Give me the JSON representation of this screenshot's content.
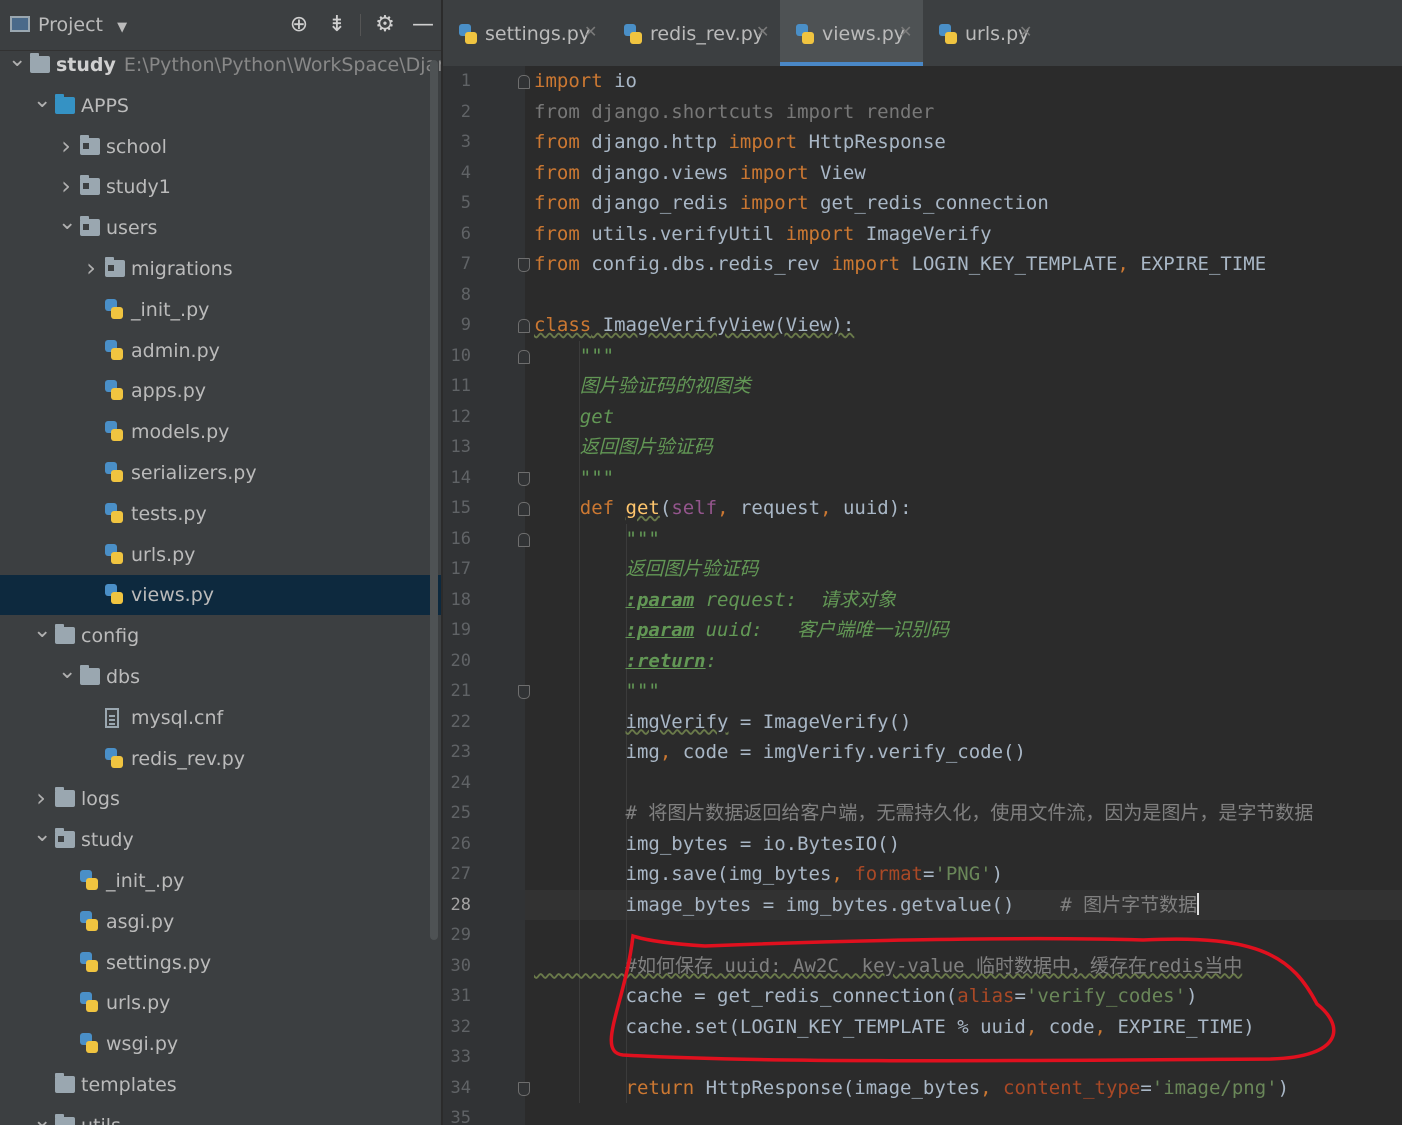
{
  "project_panel": {
    "title": "Project",
    "header_icons": [
      "locate-icon",
      "collapse-icon",
      "gear-icon",
      "minimize-icon"
    ],
    "tree": [
      {
        "label": "study",
        "path": "E:\\Python\\Python\\WorkSpace\\Django\\s",
        "depth": 0,
        "type": "folder",
        "expanded": true
      },
      {
        "label": "APPS",
        "depth": 1,
        "type": "folder-blue",
        "expanded": true
      },
      {
        "label": "school",
        "depth": 2,
        "type": "package",
        "expanded": false
      },
      {
        "label": "study1",
        "depth": 2,
        "type": "package",
        "expanded": false
      },
      {
        "label": "users",
        "depth": 2,
        "type": "package",
        "expanded": true
      },
      {
        "label": "migrations",
        "depth": 3,
        "type": "package",
        "expanded": false
      },
      {
        "label": "_init_.py",
        "depth": 3,
        "type": "py"
      },
      {
        "label": "admin.py",
        "depth": 3,
        "type": "py"
      },
      {
        "label": "apps.py",
        "depth": 3,
        "type": "py"
      },
      {
        "label": "models.py",
        "depth": 3,
        "type": "py"
      },
      {
        "label": "serializers.py",
        "depth": 3,
        "type": "py"
      },
      {
        "label": "tests.py",
        "depth": 3,
        "type": "py"
      },
      {
        "label": "urls.py",
        "depth": 3,
        "type": "py"
      },
      {
        "label": "views.py",
        "depth": 3,
        "type": "py",
        "selected": true
      },
      {
        "label": "config",
        "depth": 1,
        "type": "folder",
        "expanded": true
      },
      {
        "label": "dbs",
        "depth": 2,
        "type": "folder",
        "expanded": true
      },
      {
        "label": "mysql.cnf",
        "depth": 3,
        "type": "cnf"
      },
      {
        "label": "redis_rev.py",
        "depth": 3,
        "type": "py"
      },
      {
        "label": "logs",
        "depth": 1,
        "type": "folder",
        "expanded": false
      },
      {
        "label": "study",
        "depth": 1,
        "type": "package",
        "expanded": true
      },
      {
        "label": "_init_.py",
        "depth": 2,
        "type": "py"
      },
      {
        "label": "asgi.py",
        "depth": 2,
        "type": "py"
      },
      {
        "label": "settings.py",
        "depth": 2,
        "type": "py"
      },
      {
        "label": "urls.py",
        "depth": 2,
        "type": "py"
      },
      {
        "label": "wsgi.py",
        "depth": 2,
        "type": "py"
      },
      {
        "label": "templates",
        "depth": 1,
        "type": "folder"
      },
      {
        "label": "utils",
        "depth": 1,
        "type": "folder",
        "expanded": true
      }
    ]
  },
  "tabs": [
    {
      "label": "settings.py",
      "active": false
    },
    {
      "label": "redis_rev.py",
      "active": false
    },
    {
      "label": "views.py",
      "active": true
    },
    {
      "label": "urls.py",
      "active": false
    }
  ],
  "editor": {
    "current_line": 28,
    "lines": [
      [
        [
          "import",
          "kw"
        ],
        [
          " io",
          ""
        ]
      ],
      [
        [
          "from django.shortcuts import render",
          "faint"
        ]
      ],
      [
        [
          "from",
          "kw"
        ],
        [
          " django.http ",
          ""
        ],
        [
          "import",
          "kw"
        ],
        [
          " HttpResponse",
          ""
        ]
      ],
      [
        [
          "from",
          "kw"
        ],
        [
          " django.views ",
          ""
        ],
        [
          "import",
          "kw"
        ],
        [
          " View",
          ""
        ]
      ],
      [
        [
          "from",
          "kw"
        ],
        [
          " django_redis ",
          ""
        ],
        [
          "import",
          "kw"
        ],
        [
          " get_redis_connection",
          ""
        ]
      ],
      [
        [
          "from",
          "kw"
        ],
        [
          " utils.verifyUtil ",
          ""
        ],
        [
          "import",
          "kw"
        ],
        [
          " ImageVerify",
          ""
        ]
      ],
      [
        [
          "from",
          "kw"
        ],
        [
          " config.dbs.redis_rev ",
          ""
        ],
        [
          "import",
          "kw"
        ],
        [
          " LOGIN_KEY_TEMPLATE",
          ""
        ],
        [
          ",",
          "kw"
        ],
        [
          " EXPIRE_TIME",
          ""
        ]
      ],
      [],
      [
        [
          "class",
          "kw wavy"
        ],
        [
          " ImageVerifyView(View):",
          "wavy"
        ]
      ],
      [
        [
          "    \"\"\"",
          "doc"
        ]
      ],
      [
        [
          "    图片验证码的视图类",
          "doc"
        ]
      ],
      [
        [
          "    get",
          "doc"
        ]
      ],
      [
        [
          "    返回图片验证码",
          "doc"
        ]
      ],
      [
        [
          "    \"\"\"",
          "doc"
        ]
      ],
      [
        [
          "    ",
          ""
        ],
        [
          "def",
          "kw"
        ],
        [
          " ",
          ""
        ],
        [
          "get",
          "fn wavy"
        ],
        [
          "(",
          ""
        ],
        [
          "self",
          "self"
        ],
        [
          ",",
          "kw"
        ],
        [
          " request",
          ""
        ],
        [
          ",",
          "kw"
        ],
        [
          " uuid):",
          ""
        ]
      ],
      [
        [
          "        \"\"\"",
          "doc"
        ]
      ],
      [
        [
          "        返回图片验证码",
          "doc"
        ]
      ],
      [
        [
          "        ",
          ""
        ],
        [
          ":param",
          "doctag"
        ],
        [
          " request:  请求对象",
          "doc"
        ]
      ],
      [
        [
          "        ",
          ""
        ],
        [
          ":param",
          "doctag"
        ],
        [
          " uuid:   客户端唯一识别码",
          "doc"
        ]
      ],
      [
        [
          "        ",
          ""
        ],
        [
          ":return",
          "doctag"
        ],
        [
          ":",
          "doc"
        ]
      ],
      [
        [
          "        \"\"\"",
          "doc"
        ]
      ],
      [
        [
          "        ",
          ""
        ],
        [
          "imgVerify",
          "wavy"
        ],
        [
          " = ImageVerify()",
          ""
        ]
      ],
      [
        [
          "        img",
          ""
        ],
        [
          ",",
          "kw"
        ],
        [
          " code = imgVerify.verify_code()",
          ""
        ]
      ],
      [],
      [
        [
          "        # 将图片数据返回给客户端，无需持久化，使用文件流，因为是图片，是字节数据",
          "cmt"
        ]
      ],
      [
        [
          "        img_bytes = io.BytesIO()",
          ""
        ]
      ],
      [
        [
          "        img.save(img_bytes",
          ""
        ],
        [
          ",",
          "kw"
        ],
        [
          " ",
          ""
        ],
        [
          "format",
          "param"
        ],
        [
          "=",
          ""
        ],
        [
          "'PNG'",
          "str"
        ],
        [
          ")",
          ""
        ]
      ],
      [
        [
          "        image_bytes = img_bytes.getvalue()    ",
          ""
        ],
        [
          "# 图片字节数据",
          "cmt"
        ]
      ],
      [],
      [
        [
          "        #如何保存 uuid: Aw2C  key-value 临时数据中，缓存在redis当中",
          "cmt wavy"
        ]
      ],
      [
        [
          "        cache = get_redis_connection(",
          ""
        ],
        [
          "alias",
          "param"
        ],
        [
          "=",
          ""
        ],
        [
          "'verify_codes'",
          "str"
        ],
        [
          ")",
          ""
        ]
      ],
      [
        [
          "        cache.set(LOGIN_KEY_TEMPLATE % uuid",
          ""
        ],
        [
          ",",
          "kw"
        ],
        [
          " code",
          ""
        ],
        [
          ",",
          "kw"
        ],
        [
          " EXPIRE_TIME)",
          ""
        ]
      ],
      [],
      [
        [
          "        ",
          ""
        ],
        [
          "return",
          "kw"
        ],
        [
          " HttpResponse(image_bytes",
          ""
        ],
        [
          ",",
          "kw"
        ],
        [
          " ",
          ""
        ],
        [
          "content_type",
          "param"
        ],
        [
          "=",
          ""
        ],
        [
          "'image/png'",
          "str"
        ],
        [
          ")",
          ""
        ]
      ],
      []
    ]
  },
  "annotation": {
    "color": "#e0101e"
  }
}
